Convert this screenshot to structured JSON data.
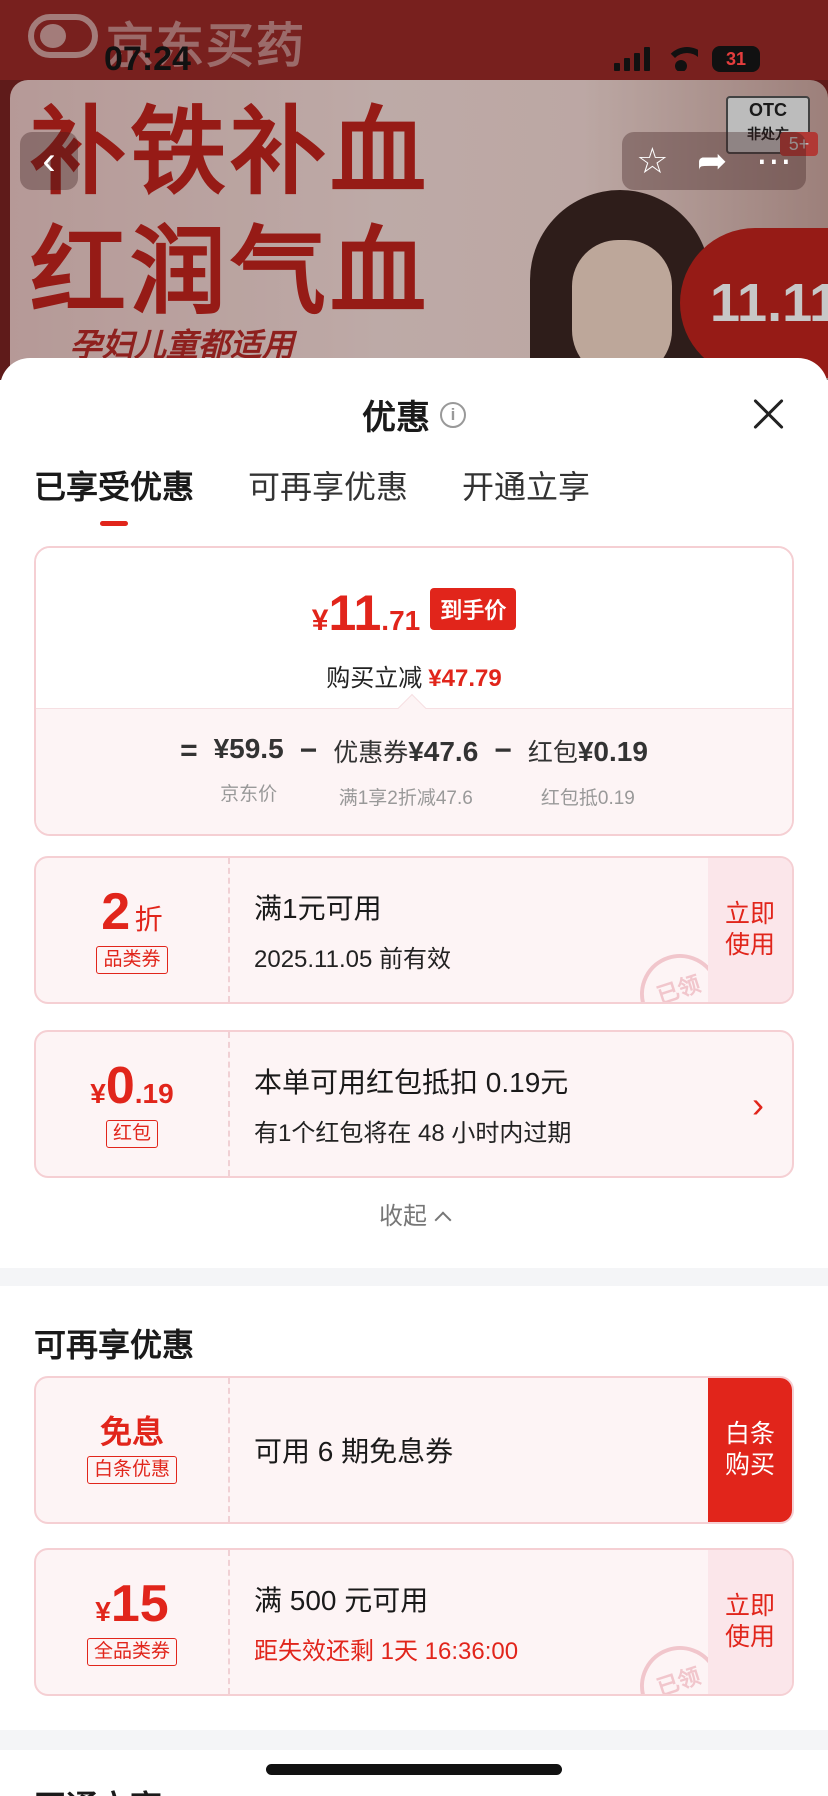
{
  "status_bar": {
    "time": "07:24",
    "battery": "31"
  },
  "banner": {
    "brand": "京东买药",
    "headline_line1": "补铁补血",
    "headline_line2": "红润气血",
    "subline": "孕妇儿童都适用",
    "otc_label": "OTC",
    "rx_label": "非处方",
    "age_badge": "5+",
    "sale_badge": "11.11"
  },
  "sheet": {
    "title": "优惠",
    "info_icon": "i",
    "tabs": [
      {
        "label": "已享受优惠",
        "active": true
      },
      {
        "label": "可再享优惠",
        "active": false
      },
      {
        "label": "开通立享",
        "active": false
      }
    ],
    "summary": {
      "currency": "¥",
      "price_int": "11",
      "price_dec": ".71",
      "price_tag": "到手价",
      "save_label": "购买立减",
      "save_amount": "¥47.79",
      "formula": {
        "eq": "=",
        "minus": "−",
        "items": [
          {
            "value": "¥59.5",
            "label": "京东价"
          },
          {
            "prefix": "优惠券",
            "value": "¥47.6",
            "label": "满1享2折减47.6"
          },
          {
            "prefix": "红包",
            "value": "¥0.19",
            "label": "红包抵0.19"
          }
        ]
      }
    },
    "applied_coupons": [
      {
        "amount": "2",
        "unit": "折",
        "tag": "品类券",
        "title": "满1元可用",
        "desc": "2025.11.05 前有效",
        "action": "立即使用",
        "stamp": "已领"
      },
      {
        "currency": "¥",
        "amount": "0",
        "decimal": ".19",
        "tag": "红包",
        "title": "本单可用红包抵扣 0.19元",
        "desc": "有1个红包将在 48 小时内过期",
        "arrow": "›"
      }
    ],
    "collapse_label": "收起",
    "more_section": {
      "title": "可再享优惠",
      "coupons": [
        {
          "amount": "免息",
          "tag": "白条优惠",
          "title": "可用 6 期免息券",
          "action": "白条购买"
        },
        {
          "currency": "¥",
          "amount": "15",
          "tag": "全品类券",
          "title": "满 500 元可用",
          "desc": "距失效还剩 1天 16:36:00",
          "action": "立即使用",
          "stamp": "已领"
        }
      ]
    },
    "open_section": {
      "title": "开通立享"
    }
  },
  "colors": {
    "accent": "#e1251b",
    "coupon_bg": "#fdf4f5",
    "coupon_border": "#f5cfd3"
  }
}
